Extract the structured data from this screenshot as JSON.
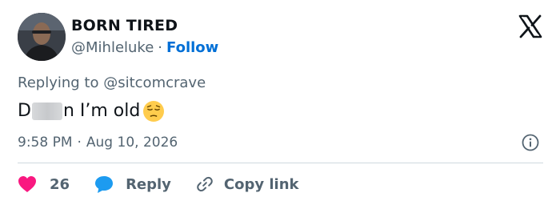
{
  "author": {
    "display_name": "BORN TIRED",
    "handle": "@Mihleluke",
    "separator": "·",
    "follow_label": "Follow"
  },
  "brand": {
    "logo": "x-logo-icon"
  },
  "reply_context": {
    "prefix": "Replying to",
    "handle": "@sitcomcrave"
  },
  "tweet": {
    "text_start": "D",
    "text_end": "n I’m old",
    "emoji": "pensive-face-emoji"
  },
  "meta": {
    "time": "9:58 PM",
    "separator": "·",
    "date": "Aug 10, 2026"
  },
  "actions": {
    "like_count": "26",
    "reply_label": "Reply",
    "copy_link_label": "Copy link"
  },
  "colors": {
    "text": "#0f1419",
    "secondary": "#536471",
    "link": "#006fd6",
    "like": "#f91880",
    "reply": "#1d9bf0",
    "divider": "#cfd9de"
  }
}
